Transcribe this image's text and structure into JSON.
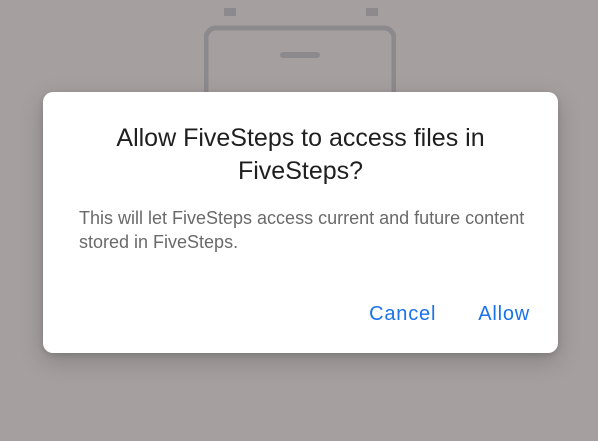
{
  "background": {
    "scrim_color": "#a59f9f",
    "icon": "calendar-folder-icon"
  },
  "dialog": {
    "title": "Allow FiveSteps to access files in FiveSteps?",
    "message": "This will let FiveSteps access current and future content stored in FiveSteps.",
    "cancel_label": "Cancel",
    "allow_label": "Allow",
    "accent_color": "#1a73e8"
  }
}
